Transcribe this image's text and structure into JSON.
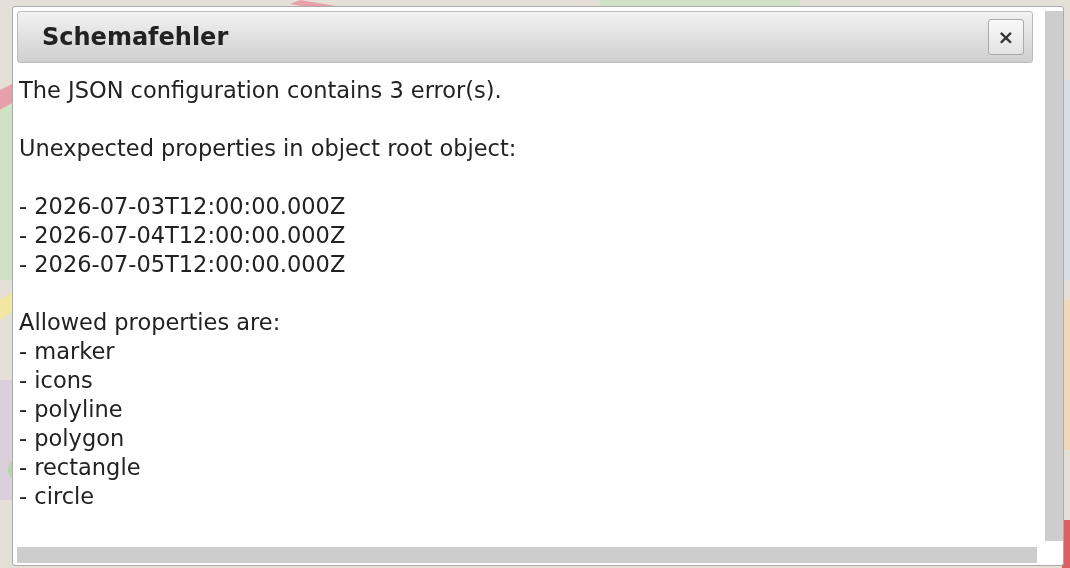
{
  "dialog": {
    "title": "Schemafehler",
    "close_label": "×",
    "blocks": [
      {
        "lines": [
          "The JSON configuration contains 3 error(s)."
        ]
      },
      {
        "lines": [
          "Unexpected properties in object root object:"
        ]
      },
      {
        "lines": [
          "- 2026-07-03T12:00:00.000Z",
          "- 2026-07-04T12:00:00.000Z",
          "- 2026-07-05T12:00:00.000Z"
        ]
      },
      {
        "lines": [
          "Allowed properties are:",
          "- marker",
          "- icons",
          "- polyline",
          "- polygon",
          "- rectangle",
          "- circle"
        ]
      }
    ]
  }
}
